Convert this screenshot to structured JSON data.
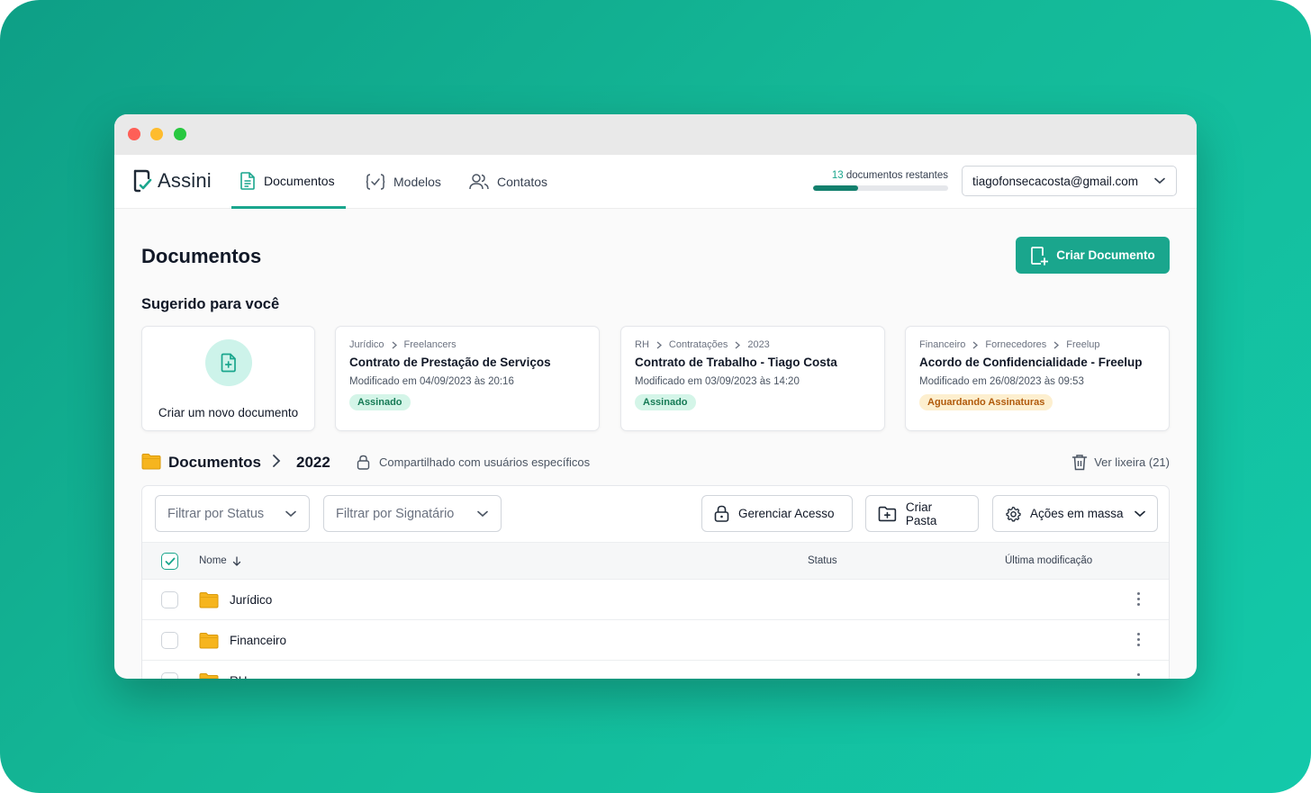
{
  "app": {
    "name": "Assini",
    "accent_color": "#1aa68d"
  },
  "nav": {
    "tabs": [
      {
        "label": "Documentos",
        "icon": "document-icon",
        "active": true
      },
      {
        "label": "Modelos",
        "icon": "template-icon",
        "active": false
      },
      {
        "label": "Contatos",
        "icon": "contacts-icon",
        "active": false
      }
    ],
    "quota": {
      "count": "13",
      "text": "documentos restantes",
      "fraction": 0.33
    },
    "account": {
      "email": "tiagofonsecacosta@gmail.com"
    }
  },
  "page": {
    "title": "Documentos",
    "create_button": "Criar Documento",
    "suggested_title": "Sugerido para você",
    "new_doc_label": "Criar um novo documento"
  },
  "suggestions": [
    {
      "crumbs": [
        "Jurídico",
        "Freelancers"
      ],
      "title": "Contrato de Prestação de Serviços",
      "modified": "Modificado em 04/09/2023 às 20:16",
      "status": "Assinado",
      "status_color": "green"
    },
    {
      "crumbs": [
        "RH",
        "Contratações",
        "2023"
      ],
      "title": "Contrato de Trabalho - Tiago Costa",
      "modified": "Modificado em 03/09/2023 às 14:20",
      "status": "Assinado",
      "status_color": "green"
    },
    {
      "crumbs": [
        "Financeiro",
        "Fornecedores",
        "Freelup"
      ],
      "title": "Acordo de Confidencialidade - Freelup",
      "modified": "Modificado em 26/08/2023 às 09:53",
      "status": "Aguardando Assinaturas",
      "status_color": "amber"
    }
  ],
  "path": {
    "root": "Documentos",
    "current": "2022",
    "sharing": "Compartilhado com usuários específicos",
    "trash": "Ver lixeira (21)"
  },
  "toolbar": {
    "filter_status": "Filtrar por Status",
    "filter_signer": "Filtrar por Signatário",
    "manage_access": "Gerenciar Acesso",
    "create_folder": "Criar Pasta",
    "bulk_actions": "Ações em massa"
  },
  "table": {
    "columns": {
      "name": "Nome",
      "status": "Status",
      "modified": "Última modificação"
    },
    "rows": [
      {
        "name": "Jurídico",
        "type": "folder"
      },
      {
        "name": "Financeiro",
        "type": "folder"
      },
      {
        "name": "RH",
        "type": "folder"
      }
    ]
  }
}
